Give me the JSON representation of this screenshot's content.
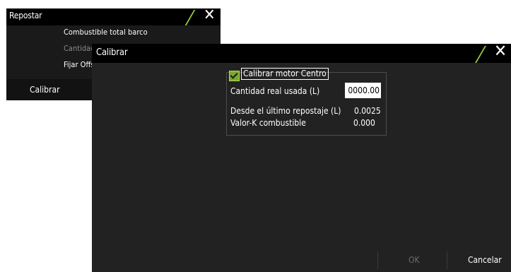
{
  "colors": {
    "accent": "#9ccc3a",
    "dialog_bg": "#222222",
    "titlebar_bg": "#000000"
  },
  "repostar": {
    "title": "Repostar",
    "rows": [
      "Combustible total barco",
      "Cantidad",
      "Fijar Offs"
    ],
    "footer": {
      "calibrar": "Calibrar"
    }
  },
  "calibrar": {
    "title": "Calibrar",
    "checkbox_label": "Calibrar motor Centro",
    "checkbox_checked": true,
    "cantidad_label": "Cantidad real usada (L)",
    "cantidad_value": "0000.00",
    "desde_label": "Desde el último repostaje (L)",
    "desde_value": "0.0025",
    "valork_label": "Valor-K combustible",
    "valork_value": "0.000",
    "ok_label": "OK",
    "cancel_label": "Cancelar"
  },
  "icons": {
    "close": "close-icon",
    "check": "check-icon"
  }
}
